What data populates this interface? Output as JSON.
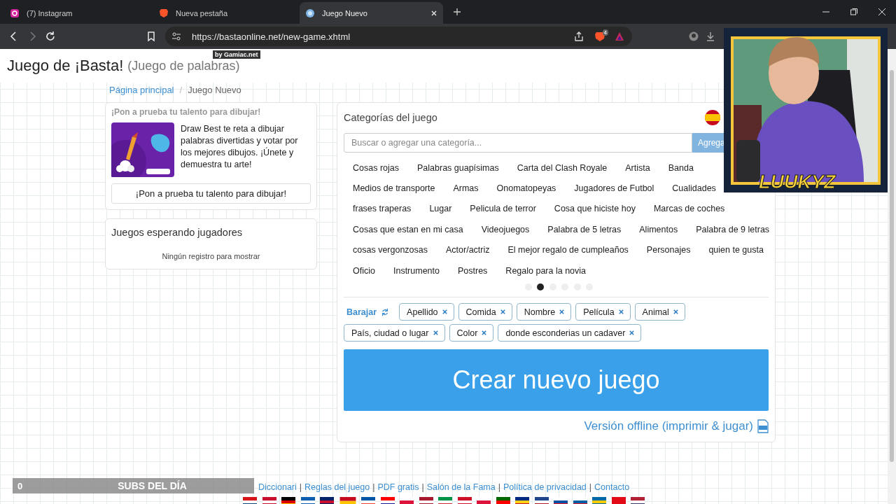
{
  "browser": {
    "tabs": [
      {
        "title": "(7) Instagram",
        "kind": "instagram",
        "selected": false
      },
      {
        "title": "Nueva pestaña",
        "kind": "lion",
        "selected": false
      },
      {
        "title": "Juego Nuevo",
        "kind": "site",
        "selected": true
      }
    ],
    "url": "https://bastaonline.net/new-game.xhtml",
    "shield_count": "4"
  },
  "header": {
    "title": "Juego de ¡Basta!",
    "subtitle": "(Juego de palabras)",
    "badge": "by Gamiac.net"
  },
  "breadcrumb_separator": "/",
  "breadcrumb": [
    {
      "label": "Página principal",
      "current": false
    },
    {
      "label": "Juego Nuevo",
      "current": true
    }
  ],
  "promo": {
    "heading": "¡Pon a prueba tu talento para dibujar!",
    "text": "Draw Best te reta a dibujar palabras divertidas y votar por los mejores dibujos. ¡Únete y demuestra tu arte!",
    "button": "¡Pon a prueba tu talento para dibujar!"
  },
  "waiting": {
    "title": "Juegos esperando jugadores",
    "empty": "Ningún registro para mostrar"
  },
  "categories": {
    "title": "Categorías del juego",
    "search_placeholder": "Buscar o agregar una categoría...",
    "add_button": "Agrega",
    "rows": [
      [
        "Cosas rojas",
        "Palabras guapísimas",
        "Carta del Clash Royale",
        "Artista",
        "Banda"
      ],
      [
        "Medios de transporte",
        "Armas",
        "Onomatopeyas",
        "Jugadores de Futbol",
        "Cualidades"
      ],
      [
        "frases traperas",
        "Lugar",
        "Pelicula de terror",
        "Cosa que hiciste hoy",
        "Marcas de coches"
      ],
      [
        "Cosas que estan en mi casa",
        "Videojuegos",
        "Palabra de 5 letras",
        "Alimentos",
        "Palabra de 9 letras"
      ],
      [
        "cosas vergonzosas",
        "Actor/actriz",
        "El mejor regalo de cumpleaños",
        "Personajes",
        "quien te gusta"
      ],
      [
        "Oficio",
        "Instrumento",
        "Postres",
        "Regalo para la novia"
      ]
    ],
    "pages": [
      {
        "selected": false
      },
      {
        "selected": true
      },
      {
        "selected": false
      },
      {
        "selected": false
      },
      {
        "selected": false
      },
      {
        "selected": false
      }
    ]
  },
  "shuffle": "Barajar",
  "selected_categories": [
    "Apellido",
    "Comida",
    "Nombre",
    "Película",
    "Animal",
    "País, ciudad o lugar",
    "Color",
    "donde esconderias un cadaver"
  ],
  "create_button": "Crear nuevo juego",
  "offline_link": "Versión offline (imprimir & jugar)",
  "footer": {
    "separator": "|",
    "links": [
      "Diccionari",
      "Reglas del juego",
      "PDF gratis",
      "Salón de la Fama",
      "Política de privacidad",
      "Contacto"
    ]
  },
  "subs_bar": {
    "count": "0",
    "label": "SUBS DEL DÍA"
  },
  "webcam": {
    "name": "LUUKYZ"
  }
}
